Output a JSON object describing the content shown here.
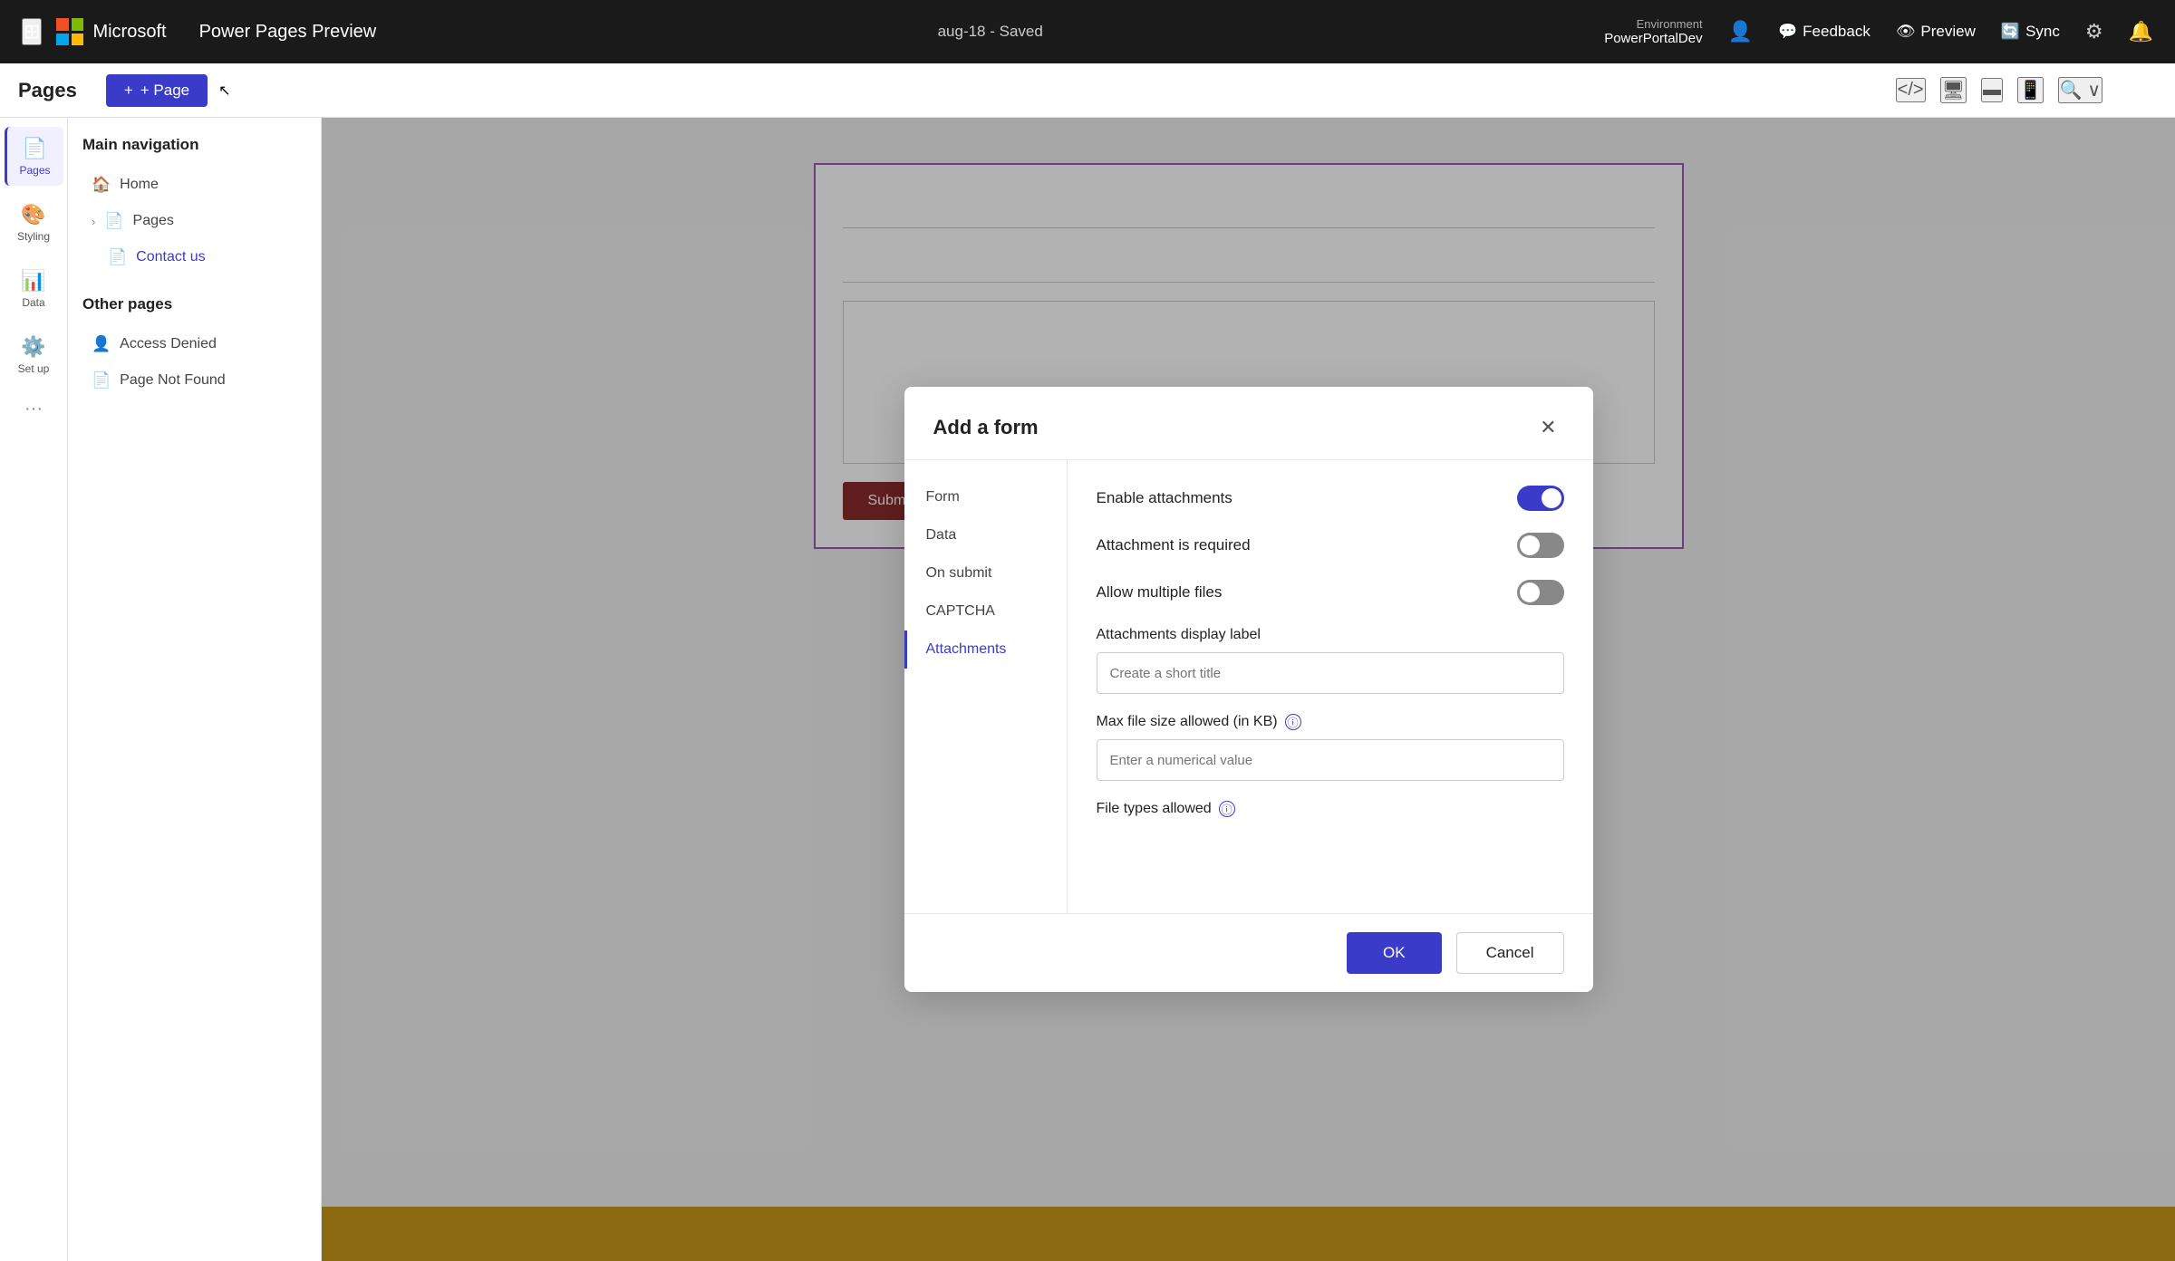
{
  "topbar": {
    "app_name": "Power Pages Preview",
    "microsoft_label": "Microsoft",
    "saved_status": "aug-18 - Saved",
    "env_label": "Environment",
    "env_name": "PowerPortalDev",
    "feedback_label": "Feedback",
    "preview_label": "Preview",
    "sync_label": "Sync"
  },
  "secondbar": {
    "pages_label": "Pages",
    "add_page_label": "+ Page"
  },
  "sidebar": {
    "items": [
      {
        "id": "pages",
        "label": "Pages",
        "icon": "📄"
      },
      {
        "id": "styling",
        "label": "Styling",
        "icon": "🎨"
      },
      {
        "id": "data",
        "label": "Data",
        "icon": "📊"
      },
      {
        "id": "setup",
        "label": "Set up",
        "icon": "⚙️"
      }
    ]
  },
  "nav": {
    "main_nav_title": "Main navigation",
    "main_items": [
      {
        "label": "Home",
        "icon": "🏠",
        "indent": false
      },
      {
        "label": "Pages",
        "icon": "📄",
        "indent": false,
        "has_chevron": true
      },
      {
        "label": "Contact us",
        "icon": "📄",
        "indent": true,
        "active": true
      }
    ],
    "other_pages_title": "Other pages",
    "other_items": [
      {
        "label": "Access Denied",
        "icon": "👤",
        "indent": false
      },
      {
        "label": "Page Not Found",
        "icon": "📄",
        "indent": false
      }
    ]
  },
  "canvas": {
    "submit_label": "Submit",
    "plus_label": "+"
  },
  "modal": {
    "title": "Add a form",
    "nav_items": [
      {
        "id": "form",
        "label": "Form",
        "active": false
      },
      {
        "id": "data",
        "label": "Data",
        "active": false
      },
      {
        "id": "on_submit",
        "label": "On submit",
        "active": false
      },
      {
        "id": "captcha",
        "label": "CAPTCHA",
        "active": false
      },
      {
        "id": "attachments",
        "label": "Attachments",
        "active": true
      }
    ],
    "attachments": {
      "enable_attachments_label": "Enable attachments",
      "enable_attachments_on": true,
      "attachment_required_label": "Attachment is required",
      "attachment_required_on": false,
      "allow_multiple_label": "Allow multiple files",
      "allow_multiple_on": false,
      "display_label_section": "Attachments display label",
      "display_label_placeholder": "Create a short title",
      "max_file_size_label": "Max file size allowed (in KB)",
      "max_file_size_placeholder": "Enter a numerical value",
      "file_types_label": "File types allowed"
    },
    "ok_label": "OK",
    "cancel_label": "Cancel"
  }
}
